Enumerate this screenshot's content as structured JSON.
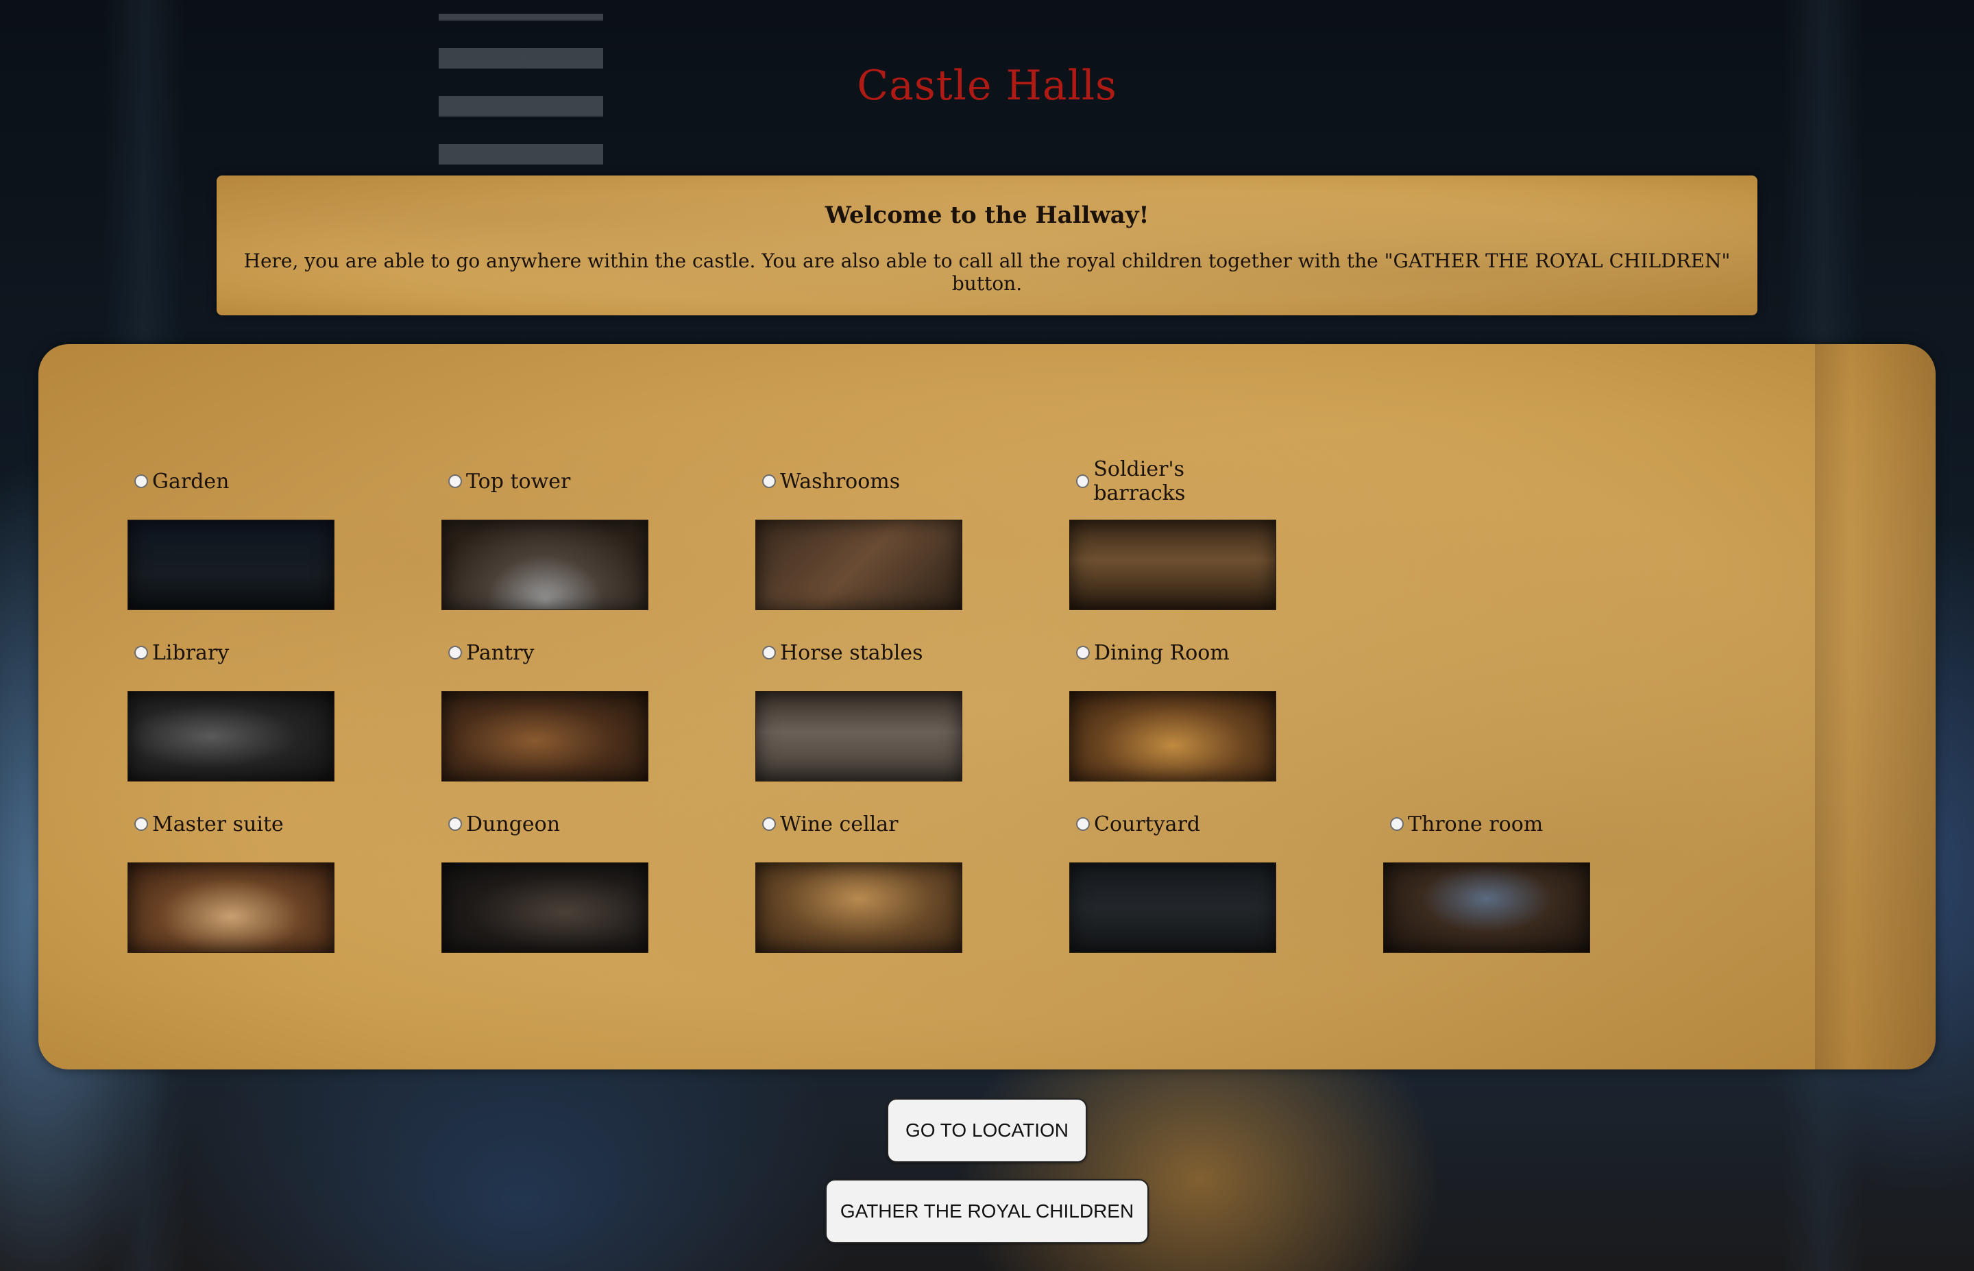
{
  "page": {
    "title": "Castle Halls"
  },
  "welcome": {
    "heading": "Welcome to the Hallway!",
    "text": "Here, you are able to go anywhere within the castle. You are also able to call all the royal children together with the \"GATHER THE ROYAL CHILDREN\" button."
  },
  "locations": [
    {
      "label": "Garden"
    },
    {
      "label": "Top tower"
    },
    {
      "label": "Washrooms"
    },
    {
      "label": "Soldier's barracks"
    },
    {
      "label": "Library"
    },
    {
      "label": "Pantry"
    },
    {
      "label": "Horse stables"
    },
    {
      "label": "Dining Room"
    },
    {
      "label": "Master suite"
    },
    {
      "label": "Dungeon"
    },
    {
      "label": "Wine cellar"
    },
    {
      "label": "Courtyard"
    },
    {
      "label": "Throne room"
    }
  ],
  "actions": {
    "go_label": "GO TO LOCATION",
    "gather_label": "GATHER THE ROYAL CHILDREN"
  },
  "colors": {
    "title": "#b01a14",
    "parchment": "#d3a75a",
    "button_bg": "#f2f2f2"
  }
}
